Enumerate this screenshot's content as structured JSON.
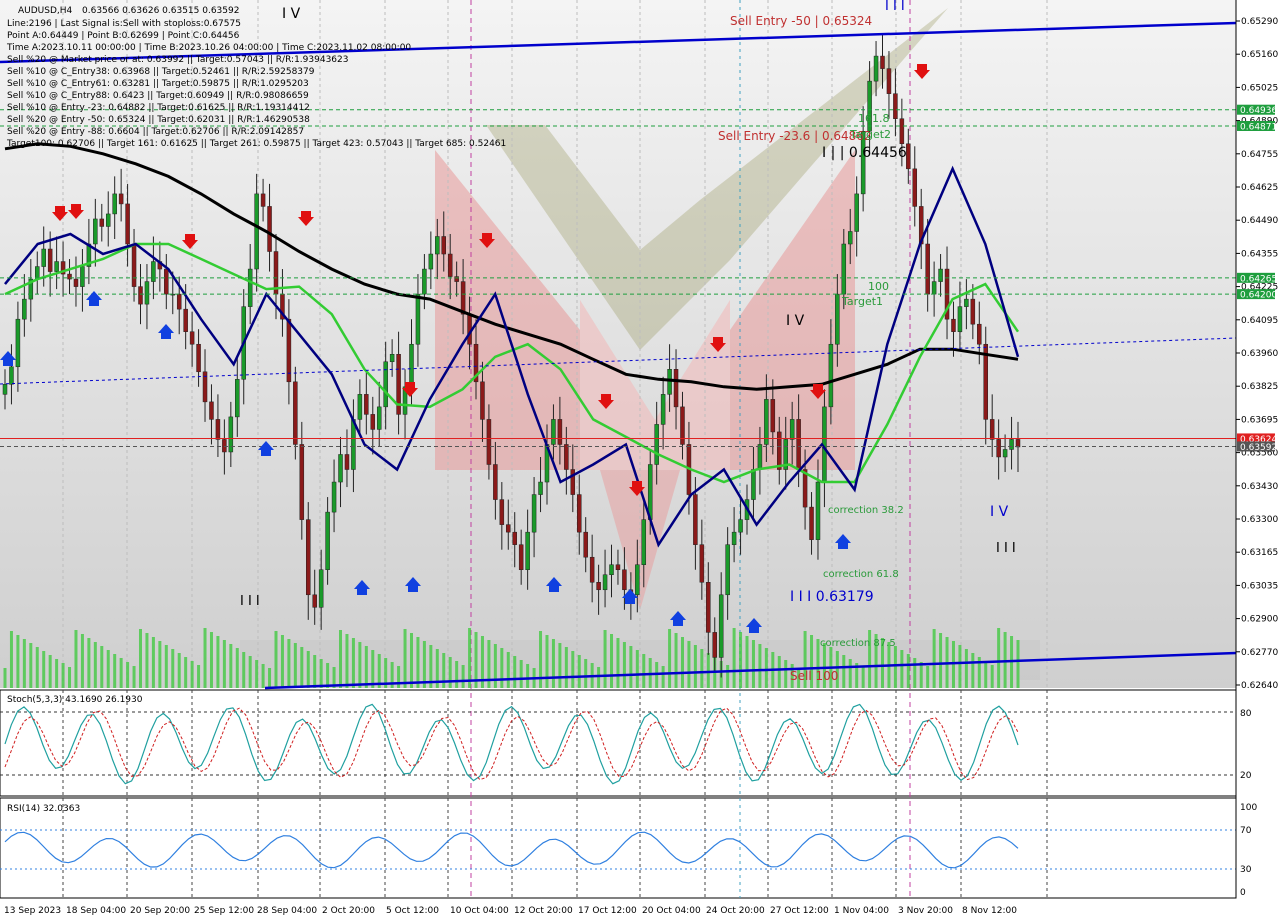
{
  "chart_data": {
    "type": "line",
    "symbol": "AUDUSD,H4",
    "ohlc": "0.63566 0.63626 0.63515 0.63592",
    "info_lines": [
      "Line:2196 | Last Signal is:Sell with stoploss:0.67575",
      "Point A:0.64449 | Point B:0.62699 | Point C:0.64456",
      "Time A:2023.10.11 00:00:00 | Time B:2023.10.26 04:00:00 | Time C:2023.11.02 08:00:00",
      "Sell %20 @ Market price or at: 0.63992 || Target:0.57043 || R/R:1.93943623",
      "Sell %10 @ C_Entry38: 0.63968 || Target:0.52461 || R/R:2.59258379",
      "Sell %10 @ C_Entry61: 0.63281 || Target:0.59875 || R/R:1.0295203",
      "Sell %10 @ C_Entry88: 0.6423 || Target:0.60949 || R/R:0.98086659",
      "Sell %10 @ Entry -23: 0.64882 || Target:0.61625 || R/R:1.19314412",
      "Sell %20 @ Entry -50: 0.65324 || Target:0.62031 || R/R:1.46290538",
      "Sell %20 @ Entry -88: 0.6604 || Target:0.62706 || R/R:2.09142857",
      "Target100: 0.62706 || Target 161: 0.61625 || Target 261: 0.59875 || Target 423: 0.57043 || Target 685: 0.52461"
    ],
    "price_axis": {
      "min": 0.6264,
      "max": 0.6536,
      "ticks": [
        "0.65290",
        "0.65160",
        "0.65025",
        "0.64890",
        "0.64755",
        "0.64625",
        "0.64490",
        "0.64355",
        "0.64225",
        "0.64095",
        "0.63960",
        "0.63825",
        "0.63695",
        "0.63560",
        "0.63430",
        "0.63300",
        "0.63165",
        "0.63035",
        "0.62900",
        "0.62770",
        "0.62640"
      ]
    },
    "price_tags": [
      {
        "label": "0.64936",
        "value": 0.64936,
        "color": "#1e9e3e"
      },
      {
        "label": "0.64871",
        "value": 0.64871,
        "color": "#1e9e3e"
      },
      {
        "label": "0.64265",
        "value": 0.64265,
        "color": "#1e9e3e"
      },
      {
        "label": "0.64200",
        "value": 0.642,
        "color": "#1e9e3e"
      },
      {
        "label": "0.63624",
        "value": 0.63624,
        "color": "#e02020"
      },
      {
        "label": "0.63592",
        "value": 0.63592,
        "color": "#555555"
      }
    ],
    "time_labels": [
      "13 Sep 2023",
      "18 Sep 04:00",
      "20 Sep 20:00",
      "25 Sep 12:00",
      "28 Sep 04:00",
      "2 Oct 20:00",
      "5 Oct 12:00",
      "10 Oct 04:00",
      "12 Oct 20:00",
      "17 Oct 12:00",
      "20 Oct 04:00",
      "24 Oct 20:00",
      "27 Oct 12:00",
      "1 Nov 04:00",
      "3 Nov 20:00",
      "8 Nov 12:00"
    ],
    "close_series": [
      0.6384,
      0.6391,
      0.641,
      0.6418,
      0.6426,
      0.6431,
      0.6438,
      0.6429,
      0.6433,
      0.6428,
      0.6426,
      0.6423,
      0.6431,
      0.644,
      0.645,
      0.6447,
      0.6452,
      0.646,
      0.6456,
      0.644,
      0.6423,
      0.6416,
      0.6425,
      0.6433,
      0.643,
      0.642,
      0.642,
      0.6414,
      0.6405,
      0.64,
      0.6389,
      0.6377,
      0.637,
      0.6362,
      0.6357,
      0.6371,
      0.6386,
      0.6415,
      0.643,
      0.646,
      0.6455,
      0.6437,
      0.642,
      0.641,
      0.6385,
      0.636,
      0.633,
      0.63,
      0.6295,
      0.631,
      0.6333,
      0.6345,
      0.6356,
      0.635,
      0.637,
      0.638,
      0.6372,
      0.6366,
      0.6375,
      0.6393,
      0.6396,
      0.6372,
      0.6383,
      0.64,
      0.642,
      0.643,
      0.6436,
      0.6443,
      0.6436,
      0.6427,
      0.6425,
      0.6412,
      0.64,
      0.6385,
      0.637,
      0.6352,
      0.6338,
      0.6328,
      0.6325,
      0.632,
      0.631,
      0.6325,
      0.634,
      0.6345,
      0.636,
      0.637,
      0.636,
      0.635,
      0.634,
      0.6325,
      0.6315,
      0.6305,
      0.6302,
      0.6308,
      0.6312,
      0.631,
      0.6302,
      0.63,
      0.6312,
      0.633,
      0.6352,
      0.6368,
      0.638,
      0.639,
      0.6375,
      0.636,
      0.634,
      0.632,
      0.6305,
      0.6285,
      0.6275,
      0.63,
      0.632,
      0.6325,
      0.633,
      0.6338,
      0.635,
      0.636,
      0.6378,
      0.6365,
      0.635,
      0.6362,
      0.637,
      0.635,
      0.6335,
      0.6322,
      0.6345,
      0.6375,
      0.64,
      0.642,
      0.644,
      0.6445,
      0.646,
      0.6485,
      0.6505,
      0.6515,
      0.651,
      0.65,
      0.649,
      0.648,
      0.647,
      0.6455,
      0.644,
      0.642,
      0.6425,
      0.643,
      0.641,
      0.6405,
      0.6415,
      0.6418,
      0.6408,
      0.64,
      0.637,
      0.6362,
      0.6355,
      0.6358,
      0.6362,
      0.6359
    ],
    "moving_averages": [
      {
        "color": "#000000",
        "values": [
          0.6478,
          0.648,
          0.6479,
          0.6476,
          0.6472,
          0.6467,
          0.646,
          0.6452,
          0.6445,
          0.6437,
          0.643,
          0.6424,
          0.642,
          0.6418,
          0.6413,
          0.6408,
          0.6404,
          0.64,
          0.6394,
          0.6388,
          0.6386,
          0.6385,
          0.6383,
          0.6382,
          0.6383,
          0.6384,
          0.6388,
          0.6392,
          0.6398,
          0.6398,
          0.6396,
          0.6394
        ]
      },
      {
        "color": "#33cc33",
        "values": [
          0.642,
          0.6426,
          0.643,
          0.6434,
          0.644,
          0.644,
          0.6434,
          0.6428,
          0.6422,
          0.6423,
          0.6412,
          0.639,
          0.6376,
          0.6375,
          0.6382,
          0.6395,
          0.64,
          0.639,
          0.637,
          0.6363,
          0.6356,
          0.635,
          0.6345,
          0.635,
          0.6352,
          0.6345,
          0.6345,
          0.6368,
          0.6395,
          0.6418,
          0.6424,
          0.6405
        ]
      },
      {
        "color": "#000080",
        "values": [
          0.6424,
          0.644,
          0.6444,
          0.6436,
          0.644,
          0.643,
          0.641,
          0.6392,
          0.642,
          0.6404,
          0.6388,
          0.636,
          0.635,
          0.6378,
          0.64,
          0.642,
          0.638,
          0.6345,
          0.6352,
          0.636,
          0.632,
          0.634,
          0.635,
          0.6328,
          0.6345,
          0.636,
          0.6342,
          0.64,
          0.644,
          0.647,
          0.644,
          0.6395
        ]
      }
    ],
    "sell_labels": [
      "Sell Entry -50 | 0.65324",
      "Sell Entry -23.6 | 0.64862",
      "Sell 100"
    ],
    "wave_labels": [
      "I V",
      "I V",
      "I V",
      "I I I",
      "I I I",
      "I I I",
      "I | | 0.64456",
      "I I I 0.63179"
    ],
    "annotations": [
      "161.8",
      "Target2",
      "100",
      "Target1",
      "correction 38.2",
      "correction 61.8",
      "correction 87.5"
    ],
    "stoch": {
      "title": "Stoch(5,3,3) 43.1690 26.1930",
      "levels": [
        "80",
        "20"
      ]
    },
    "rsi": {
      "title": "RSI(14) 32.0363",
      "levels": [
        "100",
        "70",
        "30",
        "0"
      ]
    },
    "colors": {
      "up": "#1a9a2a",
      "down": "#8b1a1a",
      "sell_zone": "#e8a0a0",
      "trend_line": "#0000cc",
      "ma_long": "#000000",
      "ma_mid": "#33cc33",
      "ma_fast": "#000080",
      "stoch_main": "#20a0a0",
      "stoch_signal": "#d02020",
      "rsi": "#3080e0"
    }
  }
}
